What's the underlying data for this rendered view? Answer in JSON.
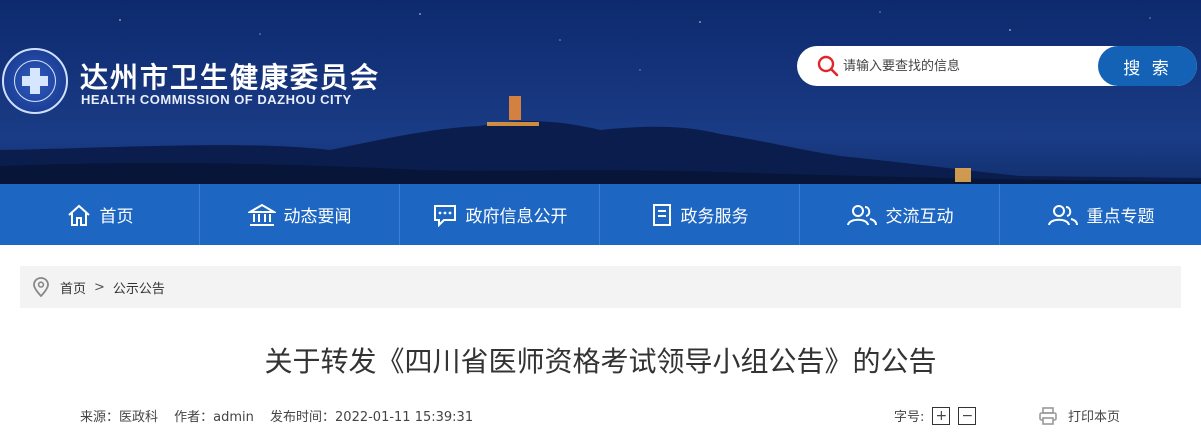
{
  "header": {
    "title": "达州市卫生健康委员会",
    "subtitle": "HEALTH COMMISSION OF DAZHOU CITY",
    "search": {
      "placeholder": "请输入要查找的信息",
      "button_label": "搜 索"
    }
  },
  "nav": {
    "items": [
      {
        "label": "首页",
        "icon": "home-icon"
      },
      {
        "label": "动态要闻",
        "icon": "building-icon"
      },
      {
        "label": "政府信息公开",
        "icon": "chat-icon"
      },
      {
        "label": "政务服务",
        "icon": "document-icon"
      },
      {
        "label": "交流互动",
        "icon": "users-icon"
      },
      {
        "label": "重点专题",
        "icon": "users-icon"
      }
    ]
  },
  "breadcrumb": {
    "home": "首页",
    "separator": ">",
    "current": "公示公告"
  },
  "article": {
    "title": "关于转发《四川省医师资格考试领导小组公告》的公告",
    "source": "来源：医政科",
    "author": "作者：admin",
    "published": "发布时间：2022-01-11 15:39:31",
    "font_size_label": "字号:",
    "font_increase": "+",
    "font_decrease": "−",
    "print_label": "打印本页"
  },
  "colors": {
    "nav_bg": "#1d67c2",
    "search_button": "#1462b6",
    "header_bg": "#15347c"
  }
}
